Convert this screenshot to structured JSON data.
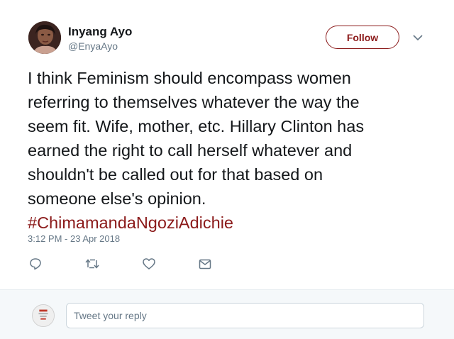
{
  "tweet": {
    "author_name": "Inyang Ayo",
    "author_handle": "@EnyaAyo",
    "follow_label": "Follow",
    "text_lines": [
      "I think Feminism should encompass women",
      "referring to themselves whatever the way the",
      "seem fit. Wife, mother, etc. Hillary Clinton has",
      "earned the right to call herself whatever and",
      "shouldn't be called out for that based on",
      "someone else's opinion."
    ],
    "hashtag": "#ChimamandaNgoziAdichie",
    "timestamp": "3:12 PM - 23 Apr 2018"
  },
  "actions": [
    {
      "name": "reply-icon"
    },
    {
      "name": "retweet-icon"
    },
    {
      "name": "like-icon"
    },
    {
      "name": "direct-message-icon"
    }
  ],
  "reply": {
    "placeholder": "Tweet your reply"
  },
  "colors": {
    "accent": "#8b1a1a",
    "text": "#14171a",
    "muted": "#657786",
    "icon": "#657786",
    "reply_bar_bg": "#f5f8fa"
  }
}
